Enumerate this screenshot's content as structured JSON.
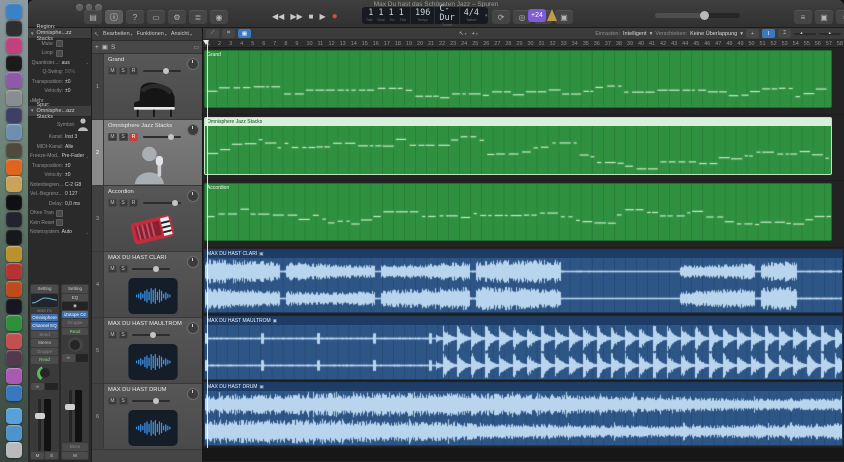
{
  "window_title": "Max Du hast das Schönsten Jazz – Spuren",
  "dock": {
    "items": [
      {
        "name": "finder",
        "color": "#3b82c4"
      },
      {
        "name": "gramophone",
        "color": "#2e2e30"
      },
      {
        "name": "photo-booth",
        "color": "#c2417c"
      },
      {
        "name": "disk-app",
        "color": "#1b1b1d"
      },
      {
        "name": "stickies",
        "color": "#8e5aa8"
      },
      {
        "name": "cat-app",
        "color": "#8a8d90"
      },
      {
        "name": "imovie",
        "color": "#3d3f66"
      },
      {
        "name": "photos",
        "color": "#6f8fb0"
      },
      {
        "name": "film-reel",
        "color": "#4e4a3e"
      },
      {
        "name": "vlc",
        "color": "#e0641e"
      },
      {
        "name": "folder-yellow",
        "color": "#c9a35a"
      },
      {
        "name": "speaker-app",
        "color": "#101012"
      },
      {
        "name": "final-cut",
        "color": "#232330"
      },
      {
        "name": "stocks",
        "color": "#17181c"
      },
      {
        "name": "coins-app",
        "color": "#b8922e"
      },
      {
        "name": "red-ring-app",
        "color": "#b83232"
      },
      {
        "name": "orange-app",
        "color": "#bf4a1e"
      },
      {
        "name": "b-app",
        "color": "#16181f"
      },
      {
        "name": "green-book",
        "color": "#2f8f3a"
      },
      {
        "name": "knife-app",
        "color": "#c25050"
      },
      {
        "name": "apple-art",
        "color": "#54384e"
      },
      {
        "name": "color-wheel",
        "color": "#a85ab0"
      },
      {
        "name": "keynote",
        "color": "#3878be"
      },
      {
        "name": "folder-documents",
        "color": "#57a0d8",
        "gap": true
      },
      {
        "name": "folder-applications",
        "color": "#4f93c8"
      },
      {
        "name": "trash",
        "color": "#b9babc"
      }
    ]
  },
  "titlebar": {
    "left_icons": [
      {
        "name": "library-icon",
        "glyph": "▤"
      },
      {
        "name": "inspector-icon",
        "glyph": "ⓘ",
        "active": true
      },
      {
        "name": "quick-help-icon",
        "glyph": "?"
      },
      {
        "name": "toolbar-icon",
        "glyph": "▭"
      },
      {
        "name": "smart-controls-icon",
        "glyph": "⚙"
      },
      {
        "name": "mixer-icon",
        "glyph": "≣"
      },
      {
        "name": "editors-icon",
        "glyph": "◉"
      }
    ],
    "transport": [
      {
        "name": "rewind-button",
        "glyph": "◀◀"
      },
      {
        "name": "forward-button",
        "glyph": "▶▶"
      },
      {
        "name": "stop-button",
        "glyph": "■"
      },
      {
        "name": "play-button",
        "glyph": "▶"
      },
      {
        "name": "record-button",
        "glyph": "●"
      }
    ],
    "cycle_icons": [
      {
        "name": "cycle-icon",
        "glyph": "⟳"
      },
      {
        "name": "autopunch-icon",
        "glyph": "◎"
      },
      {
        "name": "replace-icon",
        "glyph": "∅"
      },
      {
        "name": "tuner-icon",
        "glyph": "▣"
      }
    ],
    "badge": "+24",
    "right_icons": [
      {
        "name": "list-editors-icon",
        "glyph": "≡"
      },
      {
        "name": "note-pads-icon",
        "glyph": "▣"
      },
      {
        "name": "loop-browser-icon",
        "glyph": "⌕"
      },
      {
        "name": "browsers-icon",
        "glyph": "◫"
      }
    ]
  },
  "lcd": {
    "bar": "1",
    "beat": "1",
    "div": "1",
    "tick": "1",
    "labels": [
      "Takt",
      "Beat",
      "Div",
      "Tick"
    ],
    "tempo": "196",
    "tempo_label": "Tempo",
    "key": "C-Dur",
    "key_label": "Tonart",
    "sig": "4/4",
    "sig_label": "Taktart"
  },
  "menubar": {
    "items": [
      "Bearbeiten",
      "Funktionen",
      "Ansicht"
    ]
  },
  "arrange_toolbar": {
    "left_icons": [
      {
        "name": "automation-icon",
        "glyph": "⟋"
      },
      {
        "name": "flex-icon",
        "glyph": "⌗"
      },
      {
        "name": "capture-recording-icon",
        "glyph": "▦",
        "active": true
      }
    ],
    "pointer_tool": "↖",
    "command_tool": "+",
    "snap_label": "Einrasten:",
    "snap_value": "Intelligent",
    "drag_label": "Verschieben:",
    "drag_value": "Keine Überlappung",
    "tool_icons": [
      {
        "name": "crosshair-tool-icon",
        "glyph": "+"
      },
      {
        "name": "marquee-tool-icon",
        "glyph": "I",
        "active": true
      },
      {
        "name": "bracket-tool-icon",
        "glyph": "⌶"
      }
    ]
  },
  "inspector": {
    "region_header": "Region: Omnisphe...zz Stacks",
    "track_header": "Spur: Omnisphe...azz Stacks",
    "region_rows": [
      {
        "label": "Mute:",
        "type": "check"
      },
      {
        "label": "Loop:",
        "type": "check"
      },
      {
        "label": "Quantisier...:",
        "value": "aus",
        "dd": true
      },
      {
        "label": "Q-Swing:",
        "value": "50%",
        "dim": true
      },
      {
        "label": "Transposition:",
        "value": "±0"
      },
      {
        "label": "Velocity:",
        "value": "±0"
      },
      {
        "label": "Mehr",
        "type": "more"
      }
    ],
    "track_rows": [
      {
        "label": "Symbol:",
        "type": "symbol"
      },
      {
        "label": "Kanal:",
        "value": "Inst 3"
      },
      {
        "label": "MIDI-Kanal:",
        "value": "Alle"
      },
      {
        "label": "Freeze-Mod...:",
        "value": "Pre-Fader",
        "dd": true
      },
      {
        "label": "Transposition:",
        "value": "±0"
      },
      {
        "label": "Velocity:",
        "value": "±0"
      },
      {
        "label": "Notenbegren...:",
        "value": "C-2  G8"
      },
      {
        "label": "Vel.-Begrenz...:",
        "value": "0  127"
      },
      {
        "label": "Delay:",
        "value": "0,0 ms"
      },
      {
        "label": "Ohne Transp...:",
        "type": "check"
      },
      {
        "label": "Kein Reset:",
        "type": "check"
      },
      {
        "label": "Notensystem...:",
        "value": "Auto",
        "dd": true
      }
    ]
  },
  "strips": {
    "inst": {
      "setting": "Setting",
      "midi_fx": "MIDI FX",
      "slot1": "Omnisphere",
      "slot2": "Channel EQ",
      "send": "Send",
      "output": "Stereo",
      "group": "Gruppe",
      "automation": "Read",
      "vol": "∞",
      "mute": "M",
      "solo": "S"
    },
    "out": {
      "setting": "Setting",
      "eq": "EQ",
      "slot1": "iZotope Oz",
      "group": "Gruppe",
      "automation": "Read",
      "vol": "∞",
      "bounce": "Bnce",
      "mute": "M"
    }
  },
  "track_toolbar": {
    "add": "+",
    "dup": "▣",
    "solo": "S",
    "right_icon": "▭"
  },
  "tracks": [
    {
      "num": "1",
      "name": "Grand",
      "image": "piano",
      "buttons": [
        "M",
        "S",
        "R"
      ],
      "volume": 62
    },
    {
      "num": "2",
      "name": "Omnisphere Jazz Stacks",
      "image": "vocalist",
      "buttons": [
        "M",
        "S",
        "R"
      ],
      "rec": true,
      "selected": true,
      "volume": 76
    },
    {
      "num": "3",
      "name": "Accordion",
      "image": "accordion",
      "buttons": [
        "M",
        "S",
        "R"
      ],
      "volume": 86
    },
    {
      "num": "4",
      "name": "MAX DU HAST CLARI",
      "image": "audio",
      "buttons": [
        "M",
        "S"
      ],
      "volume": 64
    },
    {
      "num": "5",
      "name": "MAX DU HAST MAULTROM",
      "image": "audio",
      "buttons": [
        "M",
        "S"
      ],
      "volume": 56
    },
    {
      "num": "6",
      "name": "MAX DU HAST DRUM",
      "image": "audio",
      "buttons": [
        "M",
        "S"
      ],
      "volume": 63
    }
  ],
  "ruler": {
    "start": 1,
    "end": 58
  },
  "regions": [
    {
      "name": "Grand",
      "kind": "midi",
      "seed": 11,
      "cy": 0.66,
      "spread": 4
    },
    {
      "name": "Omnisphere Jazz Stacks",
      "kind": "midi",
      "selected": true,
      "seed": 23,
      "cy": 0.56,
      "spread": 7
    },
    {
      "name": "Accordion",
      "kind": "midi",
      "seed": 37,
      "cy": 0.5,
      "spread": 5
    },
    {
      "name": "MAX DU HAST CLARI",
      "kind": "audio",
      "wave": "phrases",
      "badge": "▣",
      "seed": 51
    },
    {
      "name": "MAX DU HAST MAULTROM",
      "kind": "audio",
      "wave": "spikes",
      "badge": "▣",
      "seed": 67
    },
    {
      "name": "MAX DU HAST DRUM",
      "kind": "audio",
      "wave": "dense",
      "badge": "▣",
      "seed": 83
    }
  ]
}
